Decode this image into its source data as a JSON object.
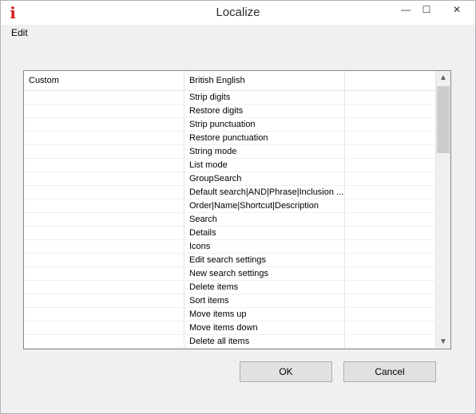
{
  "window": {
    "title": "Localize",
    "app_icon_glyph": "i",
    "controls": {
      "minimize": "—",
      "maximize": "☐",
      "close": "✕"
    }
  },
  "menu": {
    "items": [
      {
        "label": "Edit"
      }
    ]
  },
  "table": {
    "columns": [
      "Custom",
      "British English",
      ""
    ],
    "rows": [
      [
        "",
        "Strip digits",
        ""
      ],
      [
        "",
        "Restore digits",
        ""
      ],
      [
        "",
        "Strip punctuation",
        ""
      ],
      [
        "",
        "Restore punctuation",
        ""
      ],
      [
        "",
        "String mode",
        ""
      ],
      [
        "",
        "List mode",
        ""
      ],
      [
        "",
        "GroupSearch",
        ""
      ],
      [
        "",
        "Default search|AND|Phrase|Inclusion ...",
        ""
      ],
      [
        "",
        "Order|Name|Shortcut|Description",
        ""
      ],
      [
        "",
        "Search",
        ""
      ],
      [
        "",
        "Details",
        ""
      ],
      [
        "",
        "Icons",
        ""
      ],
      [
        "",
        "Edit search settings",
        ""
      ],
      [
        "",
        "New search settings",
        ""
      ],
      [
        "",
        "Delete items",
        ""
      ],
      [
        "",
        "Sort items",
        ""
      ],
      [
        "",
        "Move items up",
        ""
      ],
      [
        "",
        "Move items down",
        ""
      ],
      [
        "",
        "Delete all items",
        ""
      ]
    ],
    "scrollbar": {
      "up": "▲",
      "down": "▼"
    }
  },
  "buttons": {
    "ok": "OK",
    "cancel": "Cancel"
  }
}
